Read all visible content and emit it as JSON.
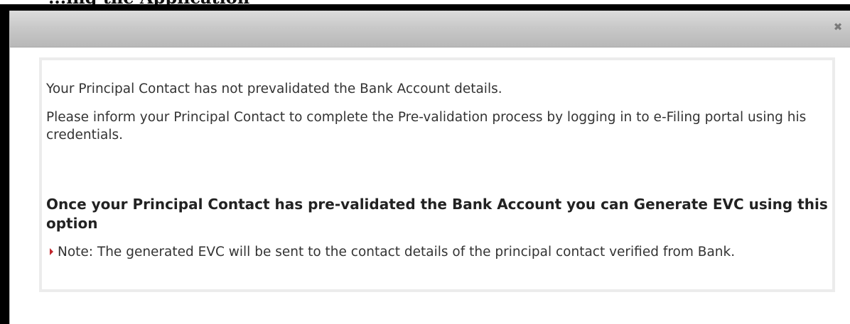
{
  "heading": {
    "text": "...ing the Application"
  },
  "dialog": {
    "close_label": "✖",
    "message_line1": "Your Principal Contact has not prevalidated the Bank Account details.",
    "message_line2": "Please inform your Principal Contact to complete the Pre-validation process by logging in to e-Filing portal using his credentials.",
    "bold_message": "Once your Principal Contact has pre-validated the Bank Account you can Generate EVC using this option",
    "note": "Note: The generated EVC will be sent to the contact details of the principal contact verified from Bank."
  },
  "colors": {
    "note_bullet": "#c0272d",
    "panel_border": "#ececec",
    "titlebar_top": "#dcdcdc",
    "titlebar_bottom": "#b8b8b8"
  },
  "icons": {
    "close": "close-icon",
    "note_bullet": "caret-right-icon"
  }
}
